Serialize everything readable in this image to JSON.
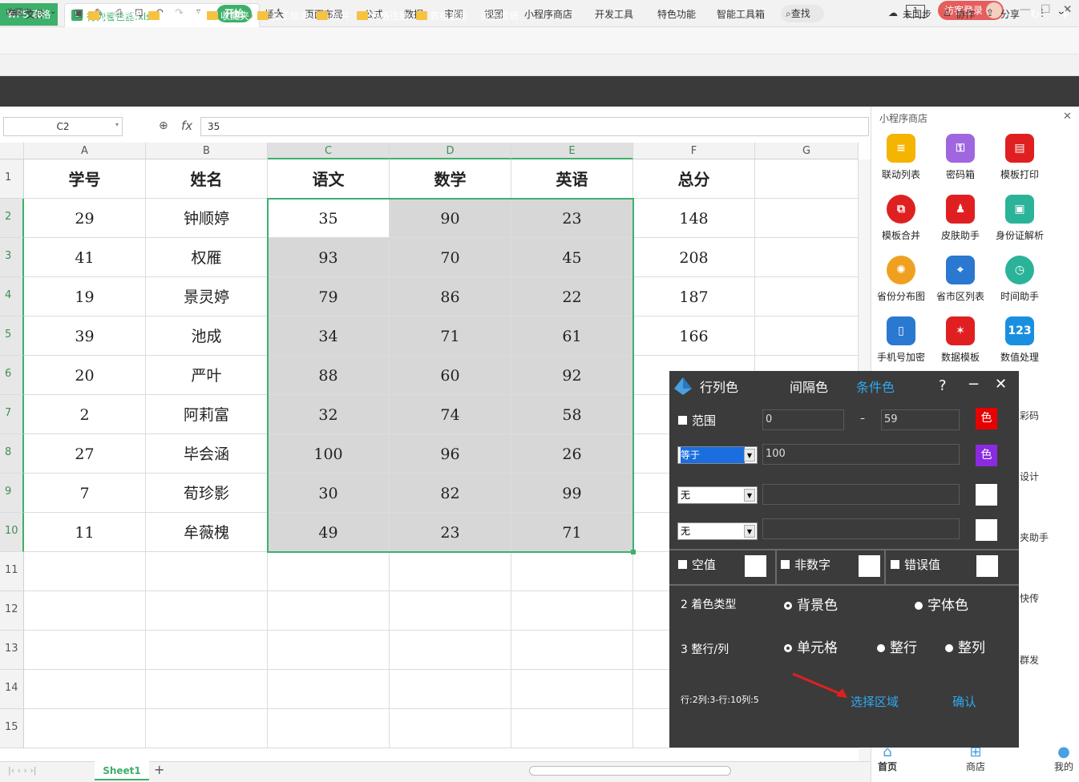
{
  "titlebar": {
    "app": "WPS 表格",
    "file": "行列着色器.xlsx",
    "new_tab": "+",
    "page_indicator": "1",
    "login": "访客登录"
  },
  "menubar": {
    "file": "文件",
    "items": [
      "开始",
      "插入",
      "页面布局",
      "公式",
      "数据",
      "审阅",
      "视图",
      "小程序商店",
      "开发工具",
      "特色功能",
      "智能工具箱"
    ],
    "search": "查找",
    "sync": "未同步",
    "collab": "协作",
    "share": "分享"
  },
  "favbar": {
    "label": "收藏夹"
  },
  "bookmarks": {
    "items": [
      "B",
      "S",
      "公司资料",
      "信息模板",
      "收藏夹",
      "员工信息",
      "合并",
      "表格连结",
      "表格查重",
      "英语成绩"
    ]
  },
  "formula": {
    "name_box": "C2",
    "fx": "fx",
    "value": "35"
  },
  "sheet": {
    "columns": [
      "A",
      "B",
      "C",
      "D",
      "E",
      "F",
      "G"
    ],
    "rows": [
      "1",
      "2",
      "3",
      "4",
      "5",
      "6",
      "7",
      "8",
      "9",
      "10",
      "11",
      "12",
      "13",
      "14",
      "15"
    ],
    "header": [
      "学号",
      "姓名",
      "语文",
      "数学",
      "英语",
      "总分"
    ],
    "data": [
      [
        "29",
        "钟顺婷",
        "35",
        "90",
        "23",
        "148"
      ],
      [
        "41",
        "权雁",
        "93",
        "70",
        "45",
        "208"
      ],
      [
        "19",
        "景灵婷",
        "79",
        "86",
        "22",
        "187"
      ],
      [
        "39",
        "池成",
        "34",
        "71",
        "61",
        "166"
      ],
      [
        "20",
        "严叶",
        "88",
        "60",
        "92",
        ""
      ],
      [
        "2",
        "阿莉富",
        "32",
        "74",
        "58",
        ""
      ],
      [
        "27",
        "毕会涵",
        "100",
        "96",
        "26",
        ""
      ],
      [
        "7",
        "荀珍影",
        "30",
        "82",
        "99",
        ""
      ],
      [
        "11",
        "牟薇槐",
        "49",
        "23",
        "71",
        ""
      ]
    ],
    "tab": "Sheet1"
  },
  "panel": {
    "title": "小程序商店",
    "apps": [
      "联动列表",
      "密码箱",
      "模板打印",
      "模板合并",
      "皮肤助手",
      "身份证解析",
      "省份分布图",
      "省市区列表",
      "时间助手",
      "手机号加密",
      "数据模板",
      "数值处理"
    ],
    "partial": [
      "彩码",
      "设计",
      "夹助手",
      "快传",
      "群发"
    ],
    "nav": [
      "首页",
      "商店",
      "我的"
    ]
  },
  "dialog": {
    "tabs": [
      "行列色",
      "间隔色",
      "条件色"
    ],
    "help": "?",
    "min": "−",
    "close": "✕",
    "range_label": "范围",
    "range_from": "0",
    "range_sep": "–",
    "range_to": "59",
    "color_btn": "色",
    "cond1": "等于",
    "cond1_value": "100",
    "cond2": "无",
    "cond3": "无",
    "empty": "空值",
    "nonnum": "非数字",
    "error": "错误值",
    "type_label": "2 着色类型",
    "bg": "背景色",
    "fg": "字体色",
    "scope_label": "3 整行/列",
    "cell": "单元格",
    "row": "整行",
    "col": "整列",
    "status": "行:2列:3-行:10列:5",
    "select": "选择区域",
    "confirm": "确认",
    "colors": {
      "red": "#e60000",
      "purple": "#8a2be2"
    }
  }
}
